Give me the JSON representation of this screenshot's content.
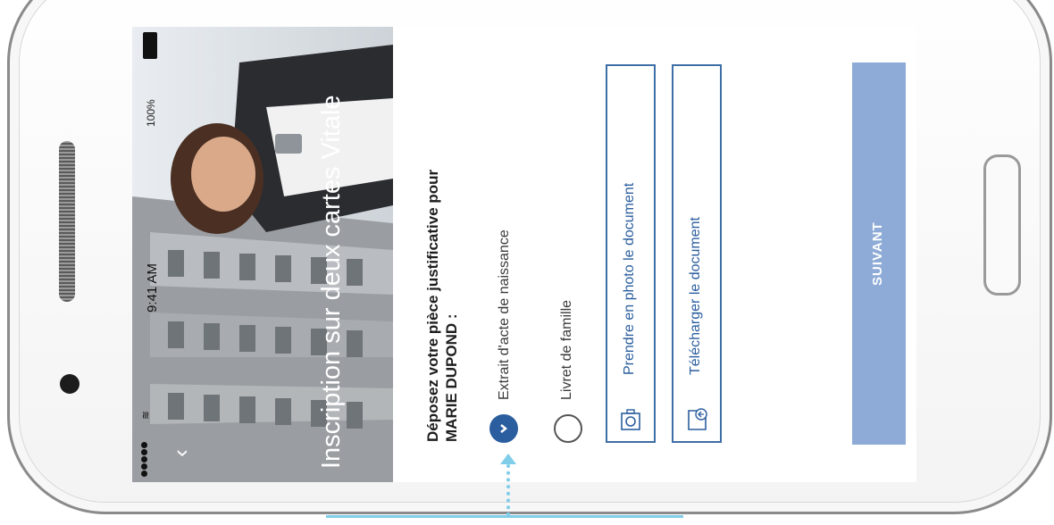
{
  "status_bar": {
    "time": "9:41 AM",
    "battery_pct": "100%"
  },
  "hero": {
    "title": "Inscription sur deux cartes Vitale"
  },
  "form": {
    "heading": "Déposez votre pièce justificative pour MARIE DUPOND :",
    "options": [
      {
        "label": "Extrait d'acte de naissance",
        "selected": true
      },
      {
        "label": "Livret de famille",
        "selected": false
      }
    ],
    "photo_button": "Prendre en photo le document",
    "upload_button": "Télécharger le document",
    "next_button": "SUIVANT"
  },
  "colors": {
    "accent": "#2b5e9e",
    "next_button": "#8dabd6",
    "callout": "#7fcde8"
  }
}
